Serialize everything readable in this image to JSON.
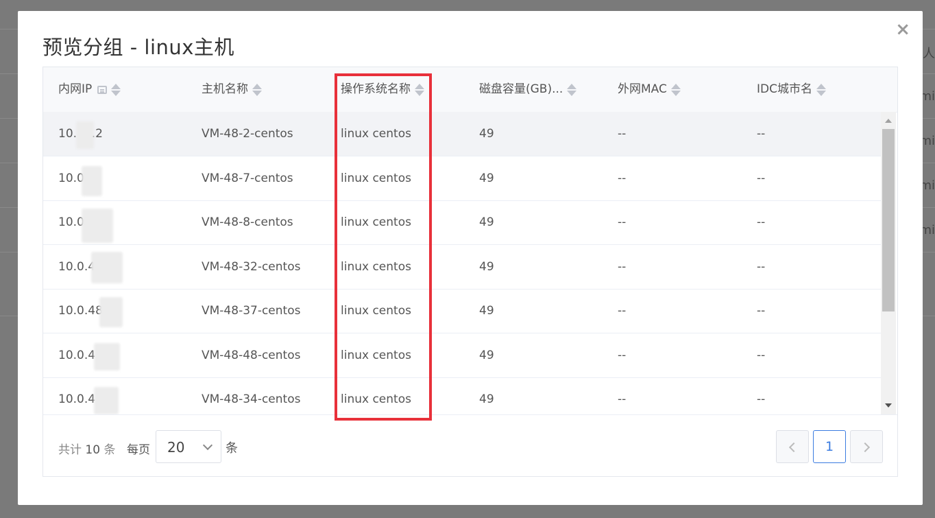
{
  "modal": {
    "title": "预览分组 - linux主机",
    "close_symbol": "×"
  },
  "table": {
    "columns": [
      {
        "label": "内网IP",
        "icons": [
          "list-icon",
          "sort-icon"
        ]
      },
      {
        "label": "主机名称",
        "icons": [
          "sort-icon"
        ]
      },
      {
        "label": "操作系统名称",
        "icons": [
          "sort-icon"
        ]
      },
      {
        "label": "磁盘容量(GB)...",
        "icons": [
          "sort-icon"
        ]
      },
      {
        "label": "外网MAC",
        "icons": [
          "sort-icon"
        ]
      },
      {
        "label": "IDC城市名",
        "icons": [
          "sort-icon"
        ]
      }
    ],
    "rows": [
      {
        "ip": "10.  .3.2",
        "host": "VM-48-2-centos",
        "os": "linux centos",
        "disk": "49",
        "mac": "--",
        "city": "--"
      },
      {
        "ip": "10.0   7",
        "host": "VM-48-7-centos",
        "os": "linux centos",
        "disk": "49",
        "mac": "--",
        "city": "--"
      },
      {
        "ip": "10.0   ",
        "host": "VM-48-8-centos",
        "os": "linux centos",
        "disk": "49",
        "mac": "--",
        "city": "--"
      },
      {
        "ip": "10.0.4",
        "host": "VM-48-32-centos",
        "os": "linux centos",
        "disk": "49",
        "mac": "--",
        "city": "--"
      },
      {
        "ip": "10.0.48",
        "host": "VM-48-37-centos",
        "os": "linux centos",
        "disk": "49",
        "mac": "--",
        "city": "--"
      },
      {
        "ip": "10.0.4",
        "host": "VM-48-48-centos",
        "os": "linux centos",
        "disk": "49",
        "mac": "--",
        "city": "--"
      },
      {
        "ip": "10.0.4",
        "host": "VM-48-34-centos",
        "os": "linux centos",
        "disk": "49",
        "mac": "--",
        "city": "--"
      }
    ]
  },
  "pagination": {
    "total_prefix": "共计",
    "total_count": "10",
    "total_suffix": "条",
    "per_page_label": "每页",
    "page_size": "20",
    "unit_label": "条",
    "current_page": "1"
  },
  "background": {
    "right_edge_texts": [
      "数人",
      "mi",
      "mi",
      "mi",
      "mi"
    ]
  },
  "colors": {
    "highlight_border": "#e8303a",
    "active_page": "#3a7be0"
  }
}
